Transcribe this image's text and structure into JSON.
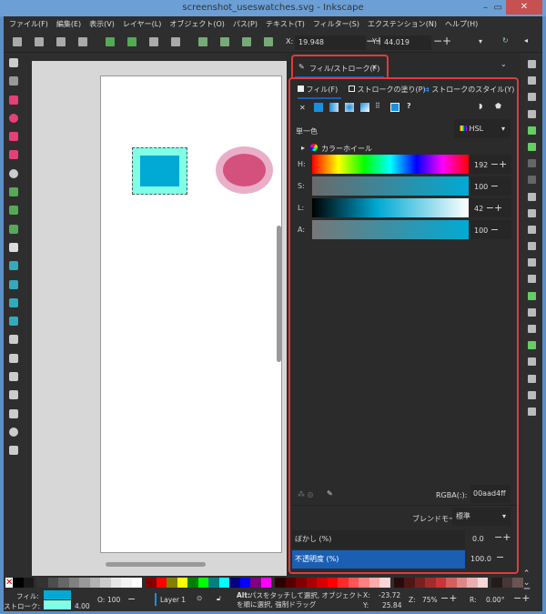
{
  "window": {
    "title": "screenshot_useswatches.svg - Inkscape"
  },
  "menu": [
    "ファイル(F)",
    "編集(E)",
    "表示(V)",
    "レイヤー(L)",
    "オブジェクト(O)",
    "パス(P)",
    "テキスト(T)",
    "フィルター(S)",
    "エクステンション(N)",
    "ヘルプ(H)"
  ],
  "toolbar": {
    "x_label": "X:",
    "x_value": "19.948",
    "y_label": "Y:",
    "y_value": "44.019"
  },
  "dialog": {
    "tab_title": "フィル/ストローク(F)",
    "subtabs": [
      "フィル(F)",
      "ストロークの塗り(P)",
      "ストロークのスタイル(Y)"
    ],
    "paint_type": "単一色",
    "mode": "HSL",
    "color_wheel": "カラーホイール",
    "sliders": [
      {
        "label": "H:",
        "value": "192"
      },
      {
        "label": "S:",
        "value": "100"
      },
      {
        "label": "L:",
        "value": "42"
      },
      {
        "label": "A:",
        "value": "100"
      }
    ],
    "rgba_label": "RGBA(:):",
    "rgba_value": "00aad4ff",
    "blend_label": "ブレンドモード:",
    "blend_value": "標準",
    "blur_label": "ぼかし (%)",
    "blur_value": "0.0",
    "opacity_label": "不透明度 (%)",
    "opacity_value": "100.0",
    "opacity_fraction": 1.0
  },
  "colors": {
    "fill": "#00aad4",
    "stroke": "#80ffe6",
    "accent": "#1a5fb4",
    "highlight": "#e23a3a"
  },
  "palette": [
    "#000000",
    "#1a1a1a",
    "#333333",
    "#4d4d4d",
    "#666666",
    "#808080",
    "#999999",
    "#b3b3b3",
    "#cccccc",
    "#e6e6e6",
    "#f2f2f2",
    "#ffffff",
    "#800000",
    "#ff0000",
    "#808000",
    "#ffff00",
    "#008000",
    "#00ff00",
    "#008080",
    "#00ffff",
    "#000080",
    "#0000ff",
    "#800080",
    "#ff00ff",
    "#2b0000",
    "#550000",
    "#800000",
    "#aa0000",
    "#d40000",
    "#ff0000",
    "#ff2a2a",
    "#ff5555",
    "#ff8080",
    "#ffaaaa",
    "#ffd5d5",
    "#280b0b",
    "#501616",
    "#782121",
    "#a02c2c",
    "#c83737",
    "#d35f5f",
    "#de8787",
    "#e9afaf",
    "#f4d7d7",
    "#241c1c",
    "#483737",
    "#6c5353"
  ],
  "status": {
    "fill_label": "フィル:",
    "stroke_label": "ストローク:",
    "stroke_width": "4.00",
    "o_label": "O:",
    "opacity": "100",
    "layer": "Layer 1",
    "message_bold": "Alt:",
    "message": "パスをタッチして選択, オブジェクトを順に選択, 強制ドラッグ",
    "x_label": "X:",
    "x": "-23.72",
    "y_label": "Y:",
    "y": "25.84",
    "z_label": "Z:",
    "zoom": "75%",
    "r_label": "R:",
    "rotation": "0.00°"
  }
}
